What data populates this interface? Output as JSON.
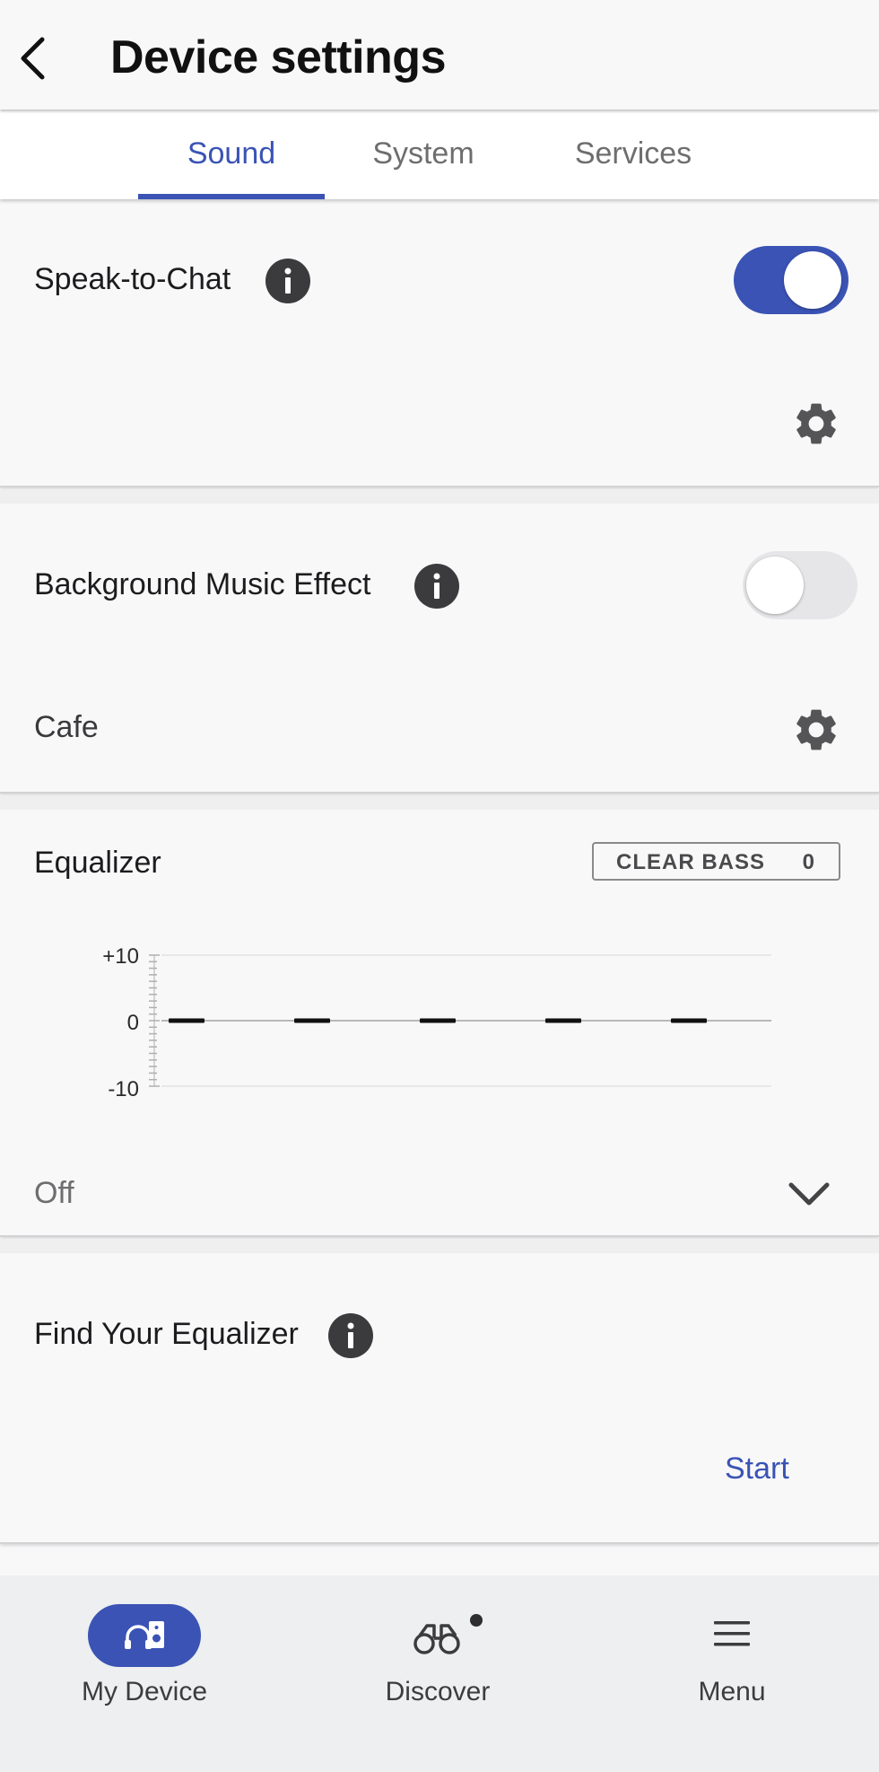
{
  "header": {
    "title": "Device settings",
    "back_icon": "chevron-left-icon"
  },
  "tabs": [
    {
      "label": "Sound",
      "active": true
    },
    {
      "label": "System",
      "active": false
    },
    {
      "label": "Services",
      "active": false
    }
  ],
  "speak_to_chat": {
    "label": "Speak-to-Chat",
    "enabled": true,
    "info_icon": "info-icon",
    "settings_icon": "gear-icon"
  },
  "background_music": {
    "label": "Background Music Effect",
    "enabled": false,
    "value": "Cafe",
    "info_icon": "info-icon",
    "settings_icon": "gear-icon"
  },
  "equalizer": {
    "label": "Equalizer",
    "clear_bass_label": "CLEAR BASS",
    "clear_bass_value": "0",
    "preset": "Off",
    "dropdown_icon": "chevron-down-icon"
  },
  "chart_data": {
    "type": "bar",
    "categories": [
      "",
      "",
      "",
      "",
      ""
    ],
    "values": [
      0,
      0,
      0,
      0,
      0
    ],
    "ylim": [
      -10,
      10
    ],
    "yticks": [
      "+10",
      "0",
      "-10"
    ]
  },
  "find_eq": {
    "label": "Find Your Equalizer",
    "action": "Start",
    "info_icon": "info-icon"
  },
  "bottom_nav": [
    {
      "label": "My Device",
      "icon": "headphones-speaker-icon",
      "active": true
    },
    {
      "label": "Discover",
      "icon": "binoculars-icon",
      "active": false,
      "badge": true
    },
    {
      "label": "Menu",
      "icon": "hamburger-menu-icon",
      "active": false
    }
  ],
  "colors": {
    "accent": "#3a53b4",
    "toggle_off": "#e6e6e8",
    "icon_dark": "#3b3b3d"
  }
}
